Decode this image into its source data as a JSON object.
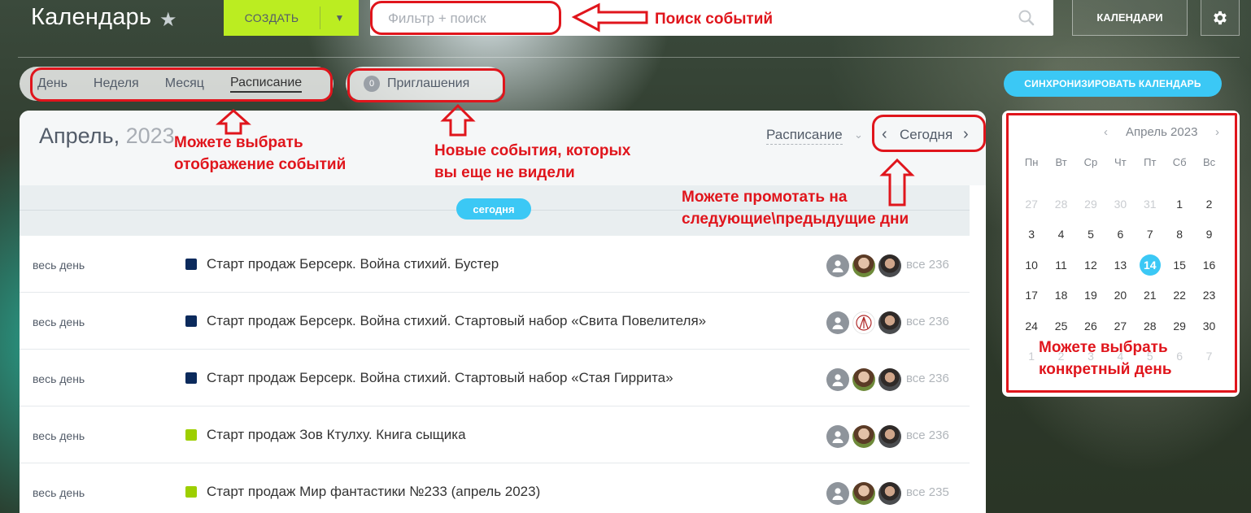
{
  "header": {
    "title": "Календарь",
    "create_label": "СОЗДАТЬ",
    "search_placeholder": "Фильтр + поиск",
    "calendars_label": "КАЛЕНДАРИ"
  },
  "view_tabs": [
    {
      "label": "День"
    },
    {
      "label": "Неделя"
    },
    {
      "label": "Месяц"
    },
    {
      "label": "Расписание",
      "active": true
    }
  ],
  "invitations": {
    "count": "0",
    "label": "Приглашения"
  },
  "sync_label": "СИНХРОНИЗИРОВАТЬ КАЛЕНДАРЬ",
  "panel": {
    "month": "Апрель,",
    "year": "2023",
    "mode": "Расписание",
    "today_nav": "Сегодня",
    "today_badge": "сегодня"
  },
  "events": [
    {
      "time": "весь день",
      "title": "Старт продаж Берсерк. Война стихий. Бустер",
      "color": "#0b2a5c",
      "count": "все 236"
    },
    {
      "time": "весь день",
      "title": "Старт продаж Берсерк. Война стихий. Стартовый набор «Свита Повелителя»",
      "color": "#0b2a5c",
      "count": "все 236"
    },
    {
      "time": "весь день",
      "title": "Старт продаж Берсерк. Война стихий. Стартовый набор «Стая Гиррита»",
      "color": "#0b2a5c",
      "count": "все 236"
    },
    {
      "time": "весь день",
      "title": "Старт продаж Зов Ктулху. Книга сыщика",
      "color": "#9dcf00",
      "count": "все 236"
    },
    {
      "time": "весь день",
      "title": "Старт продаж Мир фантастики №233 (апрель 2023)",
      "color": "#9dcf00",
      "count": "все 235"
    }
  ],
  "mini_calendar": {
    "title": "Апрель 2023",
    "weekdays": [
      "Пн",
      "Вт",
      "Ср",
      "Чт",
      "Пт",
      "Сб",
      "Вс"
    ],
    "days": [
      [
        "27",
        "28",
        "29",
        "30",
        "31",
        "1",
        "2"
      ],
      [
        "3",
        "4",
        "5",
        "6",
        "7",
        "8",
        "9"
      ],
      [
        "10",
        "11",
        "12",
        "13",
        "14",
        "15",
        "16"
      ],
      [
        "17",
        "18",
        "19",
        "20",
        "21",
        "22",
        "23"
      ],
      [
        "24",
        "25",
        "26",
        "27",
        "28",
        "29",
        "30"
      ],
      [
        "1",
        "2",
        "3",
        "4",
        "5",
        "6",
        "7"
      ]
    ],
    "today": "14"
  },
  "annotations": {
    "search": "Поиск событий",
    "view": "Можете выбрать отображение событий",
    "view_lines": [
      "Можете выбрать",
      "отображение событий"
    ],
    "invites_lines": [
      "Новые события, которых",
      "вы еще не видели"
    ],
    "nav_lines": [
      "Можете промотать на",
      "следующие\\предыдущие дни"
    ],
    "day_lines": [
      "Можете выбрать",
      "конкретный день"
    ]
  }
}
